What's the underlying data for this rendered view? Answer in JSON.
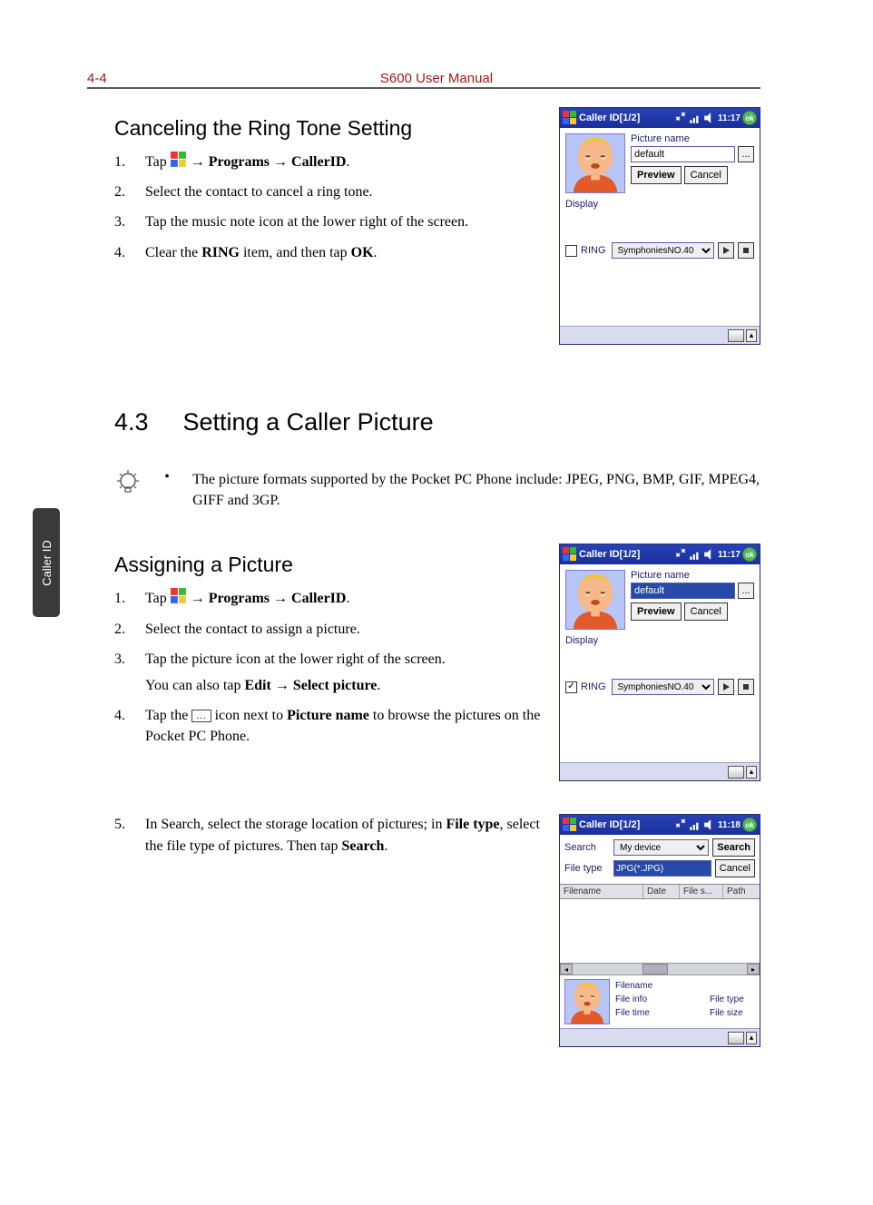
{
  "header": {
    "page_num": "4-4",
    "manual_title": "S600 User Manual"
  },
  "side_tab": "Caller ID",
  "section_cancel": {
    "heading": "Canceling the Ring Tone Setting",
    "steps": {
      "s1_pre": "Tap ",
      "s1_mid": " → ",
      "s1_b1": "Programs",
      "s1_b2": "CallerID",
      "s1_post": ".",
      "s2": "Select the contact to cancel a ring tone.",
      "s3": "Tap the music note icon at the lower right of the screen.",
      "s4_pre": "Clear the ",
      "s4_b1": "RING",
      "s4_mid": " item, and then tap ",
      "s4_b2": "OK",
      "s4_post": "."
    }
  },
  "section_43": {
    "num": "4.3",
    "title": "Setting a Caller Picture",
    "tip": "The picture formats supported by the Pocket PC Phone include: JPEG, PNG, BMP, GIF, MPEG4, GIFF and 3GP."
  },
  "section_assign": {
    "heading": "Assigning a Picture",
    "steps": {
      "s1_pre": "Tap ",
      "s1_mid": " → ",
      "s1_b1": "Programs",
      "s1_b2": "CallerID",
      "s1_post": ".",
      "s2": "Select the contact to assign a picture.",
      "s3": "Tap the picture icon at the lower right of the screen.",
      "s3b_pre": "You can also tap ",
      "s3b_b1": "Edit",
      "s3b_mid": " → ",
      "s3b_b2": "Select picture",
      "s3b_post": ".",
      "s4_pre": "Tap the ",
      "s4_mid": " icon next to ",
      "s4_b1": "Picture name",
      "s4_post": " to browse the pictures on the Pocket PC Phone.",
      "s5_pre": "In Search, select the storage location of pictures; in ",
      "s5_b1": "File type",
      "s5_mid": ", select the file type of pictures. Then tap ",
      "s5_b2": "Search",
      "s5_post": "."
    }
  },
  "ppc1": {
    "title": "Caller ID[1/2]",
    "time": "11:17",
    "picture_name_label": "Picture name",
    "picture_name_value": "default",
    "browse": "...",
    "preview": "Preview",
    "cancel": "Cancel",
    "display": "Display",
    "ring_label": "RING",
    "ring_value": "SymphoniesNO.40",
    "ring_checked": false
  },
  "ppc2": {
    "title": "Caller ID[1/2]",
    "time": "11:17",
    "picture_name_label": "Picture name",
    "picture_name_value": "default",
    "browse": "...",
    "preview": "Preview",
    "cancel": "Cancel",
    "display": "Display",
    "ring_label": "RING",
    "ring_value": "SymphoniesNO.40",
    "ring_checked": true
  },
  "ppc3": {
    "title": "Caller ID[1/2]",
    "time": "11:18",
    "search_label": "Search",
    "search_value": "My device",
    "search_btn": "Search",
    "filetype_label": "File type",
    "filetype_value": "JPG(*.JPG)",
    "cancel": "Cancel",
    "cols": {
      "c1": "Filename",
      "c2": "Date",
      "c3": "File s...",
      "c4": "Path"
    },
    "info": {
      "filename": "Filename",
      "fileinfo": "File info",
      "filetime": "File time",
      "filetype": "File type",
      "filesize": "File size"
    }
  }
}
